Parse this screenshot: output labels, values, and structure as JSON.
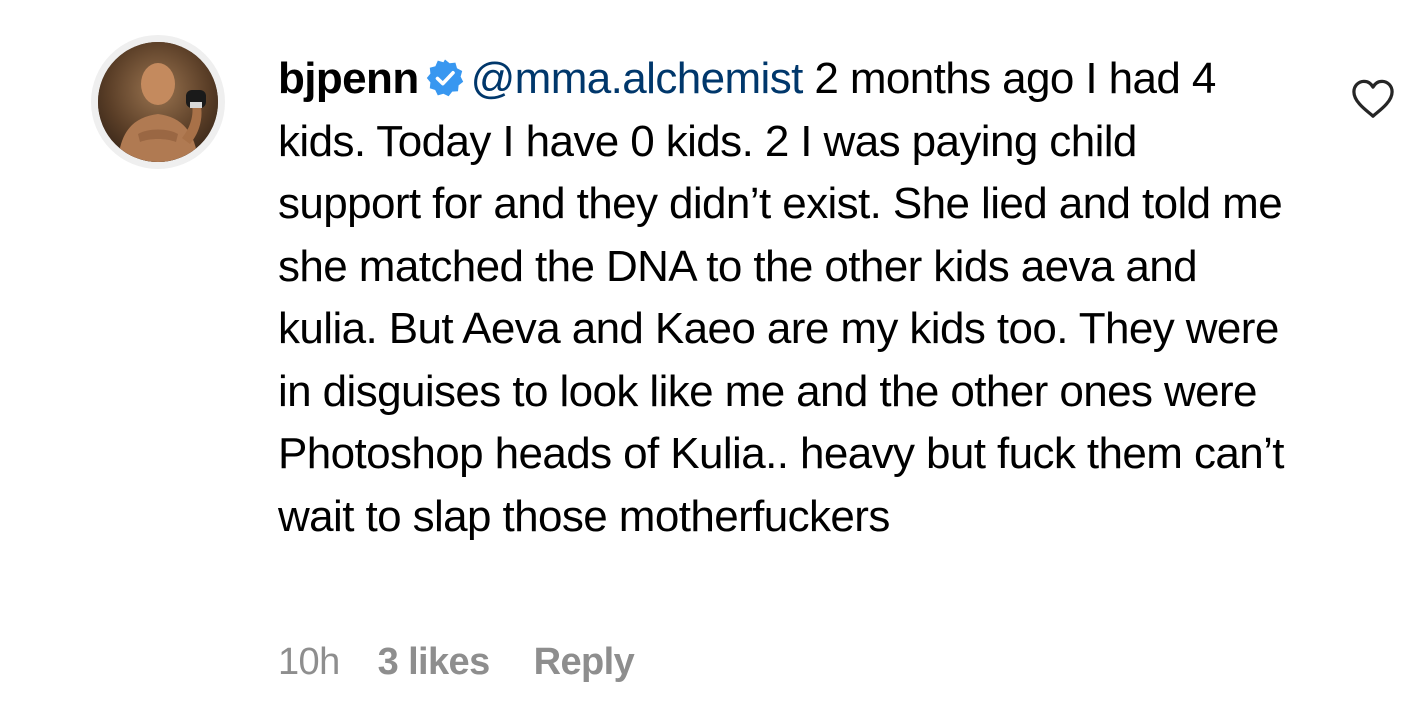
{
  "comment": {
    "avatar_icon": "profile-photo-fighter",
    "username": "bjpenn",
    "verified_icon": "verified-badge-icon",
    "mention": "@mma.alchemist",
    "text": " 2 months ago I had 4 kids. Today I have 0 kids. 2 I was paying child support for and they didn’t exist. She lied and told me she matched the DNA to the other kids aeva and kulia. But Aeva and Kaeo are my kids too. They were in disguises to look like me and the other ones were Photoshop heads of Kulia.. heavy but fuck them can’t wait to slap those motherfuckers",
    "like_icon": "heart-icon",
    "time": "10h",
    "likes": "3 likes",
    "reply_label": "Reply"
  },
  "colors": {
    "mention": "#00376b",
    "meta_gray": "#8e8e8e",
    "verified_blue": "#3897f0",
    "text": "#000000"
  }
}
